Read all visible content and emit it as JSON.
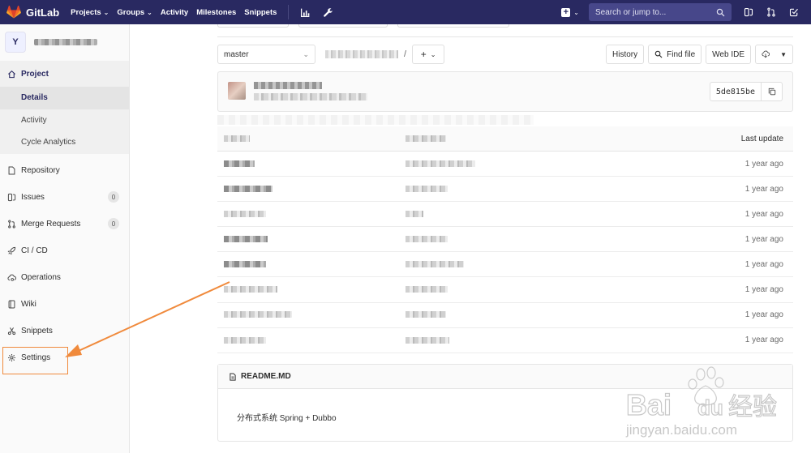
{
  "topbar": {
    "brand": "GitLab",
    "nav": [
      {
        "label": "Projects",
        "dropdown": true
      },
      {
        "label": "Groups",
        "dropdown": true
      },
      {
        "label": "Activity",
        "dropdown": false
      },
      {
        "label": "Milestones",
        "dropdown": false
      },
      {
        "label": "Snippets",
        "dropdown": false
      }
    ],
    "icons": [
      "chart-icon",
      "wrench-icon"
    ],
    "search_placeholder": "Search or jump to...",
    "right_icons": [
      "issues-icon",
      "merge-requests-icon",
      "todos-icon"
    ],
    "bg_color": "#292961"
  },
  "sidebar": {
    "avatar_letter": "Y",
    "project_header": "Project",
    "sub_items": [
      "Details",
      "Activity",
      "Cycle Analytics"
    ],
    "active_sub": "Details",
    "items": [
      {
        "label": "Repository",
        "icon": "doc-icon",
        "badge": null
      },
      {
        "label": "Issues",
        "icon": "issues-icon",
        "badge": "0"
      },
      {
        "label": "Merge Requests",
        "icon": "merge-requests-icon",
        "badge": "0"
      },
      {
        "label": "CI / CD",
        "icon": "rocket-icon",
        "badge": null
      },
      {
        "label": "Operations",
        "icon": "cloud-gear-icon",
        "badge": null
      },
      {
        "label": "Wiki",
        "icon": "book-icon",
        "badge": null
      },
      {
        "label": "Snippets",
        "icon": "scissors-icon",
        "badge": null
      },
      {
        "label": "Settings",
        "icon": "gear-icon",
        "badge": null
      }
    ]
  },
  "toolbar": {
    "branch": "master",
    "path_separator": "/",
    "add_symbol": "+",
    "history": "History",
    "find_file": "Find file",
    "web_ide": "Web IDE"
  },
  "commit": {
    "sha": "5de815be"
  },
  "file_table": {
    "last_update_header": "Last update",
    "rows": [
      {
        "updated": "1 year ago"
      },
      {
        "updated": "1 year ago"
      },
      {
        "updated": "1 year ago"
      },
      {
        "updated": "1 year ago"
      },
      {
        "updated": "1 year ago"
      },
      {
        "updated": "1 year ago"
      },
      {
        "updated": "1 year ago"
      },
      {
        "updated": "1 year ago"
      }
    ]
  },
  "readme": {
    "title": "README.MD",
    "content": "分布式系统 Spring + Dubbo"
  },
  "annotation": {
    "color": "#f08a3c"
  },
  "watermark": {
    "line1": "Bai",
    "line1b": "du",
    "line1c": "经验",
    "line2": "jingyan.baidu.com"
  }
}
